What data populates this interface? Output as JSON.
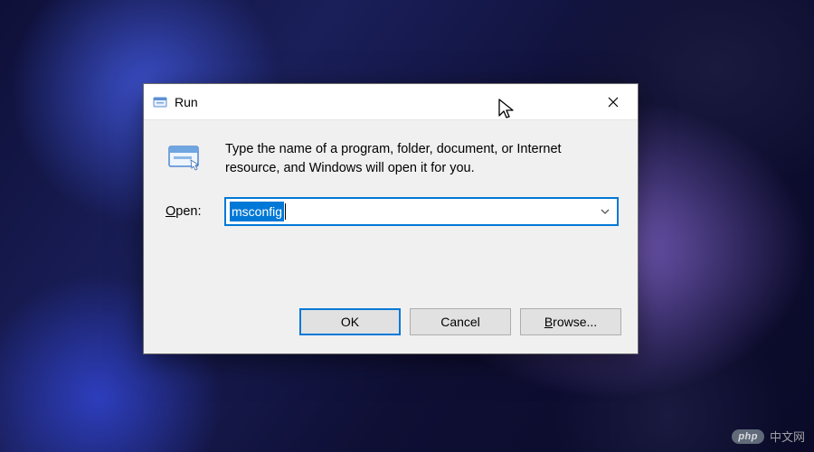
{
  "dialog": {
    "title": "Run",
    "instruction": "Type the name of a program, folder, document, or Internet resource, and Windows will open it for you.",
    "open_label_prefix": "O",
    "open_label_rest": "pen:",
    "input_value": "msconfig",
    "buttons": {
      "ok": "OK",
      "cancel": "Cancel",
      "browse_prefix": "B",
      "browse_rest": "rowse..."
    }
  },
  "watermark": {
    "badge": "php",
    "text": "中文网"
  }
}
